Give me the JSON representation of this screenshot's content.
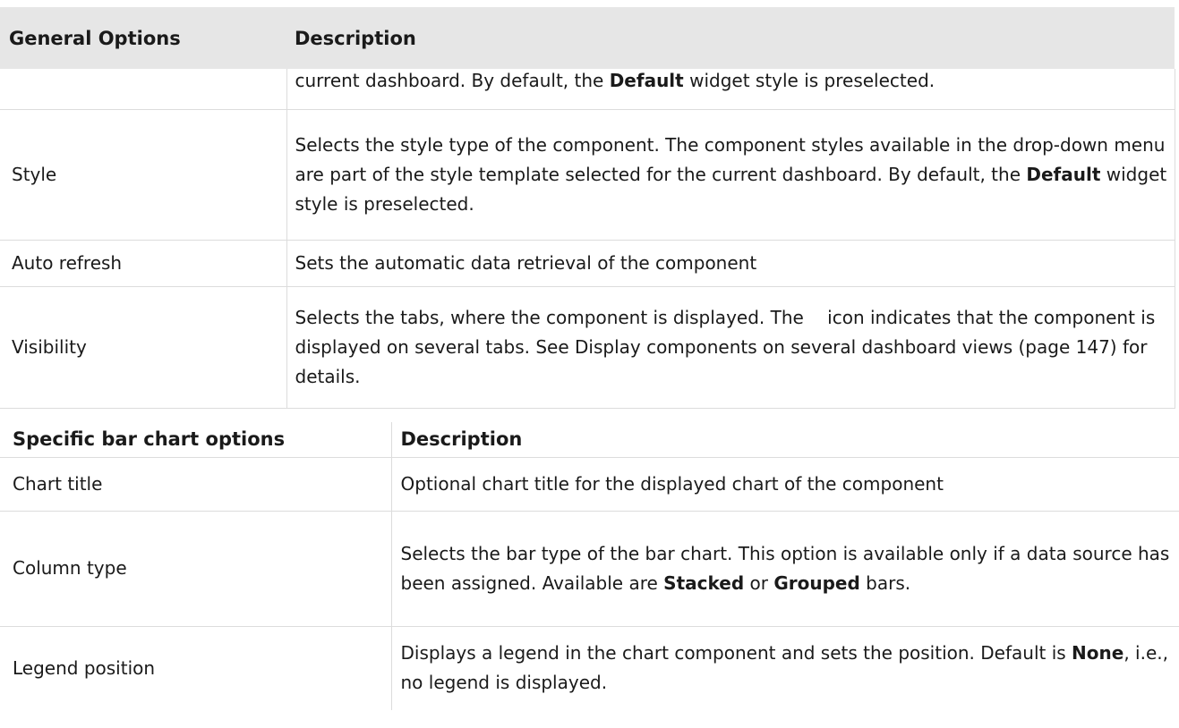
{
  "general_table": {
    "headers": [
      "General Options",
      "Description"
    ],
    "rows": [
      {
        "option": "",
        "desc": [
          {
            "t": "current dashboard. By default, the "
          },
          {
            "b": "Default"
          },
          {
            "t": " widget style is preselected."
          }
        ]
      },
      {
        "option": "Style",
        "desc": [
          {
            "t": "Selects the style type of the component. The component styles available in the drop-down menu are part of the style template selected for the current dashboard. By default, the "
          },
          {
            "b": "Default"
          },
          {
            "t": " widget style is preselected."
          }
        ]
      },
      {
        "option": "Auto refresh",
        "desc": [
          {
            "t": "Sets the automatic data retrieval of the component"
          }
        ]
      },
      {
        "option": "Visibility",
        "desc": [
          {
            "t": "Selects the tabs, where the component is displayed. The "
          },
          {
            "icon": "multi-tab-icon"
          },
          {
            "t": "icon indicates that the component is displayed on several tabs. See Display components on several dashboard views (page 147) for details."
          }
        ]
      }
    ]
  },
  "specific_table": {
    "headers": [
      "Specific bar chart options",
      "Description"
    ],
    "rows": [
      {
        "option": "Chart title",
        "desc": [
          {
            "t": "Optional chart title for the displayed chart of the component"
          }
        ]
      },
      {
        "option": "Column type",
        "desc": [
          {
            "t": "Selects the bar type of the bar chart. This option is available only if a data source has been assigned. Available are "
          },
          {
            "b": "Stacked"
          },
          {
            "t": " or "
          },
          {
            "b": "Grouped"
          },
          {
            "t": " bars."
          }
        ]
      },
      {
        "option": "Legend position",
        "desc": [
          {
            "t": "Displays a legend in the chart component and sets the position. Default is "
          },
          {
            "b": "None"
          },
          {
            "t": ", i.e., no legend is displayed."
          }
        ]
      }
    ]
  }
}
